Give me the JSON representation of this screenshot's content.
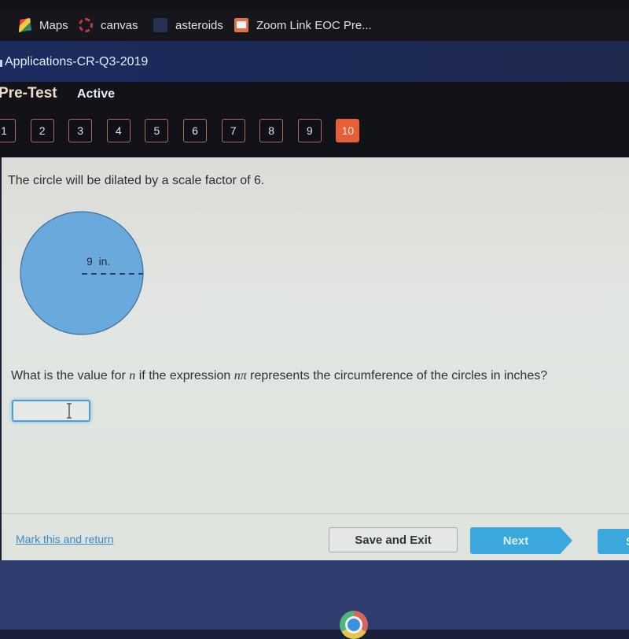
{
  "bookmarks": [
    {
      "icon": "maps-icon",
      "label": "Maps"
    },
    {
      "icon": "canvas-icon",
      "label": "canvas"
    },
    {
      "icon": "asteroids-icon",
      "label": "asteroids"
    },
    {
      "icon": "zoom-icon",
      "label": "Zoom Link EOC Pre..."
    }
  ],
  "header": {
    "course_title": "Applications-CR-Q3-2019",
    "test_name": "Pre-Test",
    "status": "Active"
  },
  "question_nav": {
    "items": [
      "1",
      "2",
      "3",
      "4",
      "5",
      "6",
      "7",
      "8",
      "9",
      "10"
    ],
    "current": "10",
    "colors": {
      "current": "#e65f36",
      "border": "#b56a58"
    }
  },
  "question": {
    "prompt": "The circle will be dilated by a scale factor of 6.",
    "figure": {
      "shape": "circle",
      "radius_label": "9  in.",
      "fill_color": "#6aa9dc"
    },
    "ask_before": "What is the value for ",
    "var_n": "n",
    "ask_middle": " if the expression ",
    "expr": "nπ",
    "ask_after": " represents the circumference of the circles in inches?",
    "answer_value": "",
    "answer_placeholder": ""
  },
  "footer": {
    "mark_link": "Mark this and return",
    "save_exit": "Save and Exit",
    "next": "Next",
    "submit": "S"
  },
  "accent_color": "#3aa8dc"
}
